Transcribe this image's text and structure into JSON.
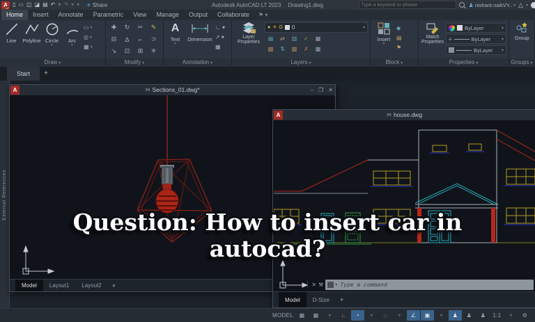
{
  "titlebar": {
    "logo_text": "A",
    "logo_badge": "LT",
    "qat_icons": [
      {
        "name": "new-file-icon",
        "glyph": "▯"
      },
      {
        "name": "open-folder-icon",
        "glyph": "▭"
      },
      {
        "name": "save-icon",
        "glyph": "◫"
      },
      {
        "name": "save-as-icon",
        "glyph": "◪"
      },
      {
        "name": "plot-icon",
        "glyph": "▤"
      },
      {
        "name": "undo-icon",
        "glyph": "↶"
      },
      {
        "name": "undo-dropdown-icon",
        "glyph": "▾",
        "dim": true
      },
      {
        "name": "redo-icon",
        "glyph": "↷",
        "dim": true
      },
      {
        "name": "redo-dropdown-icon",
        "glyph": "▾",
        "dim": true
      },
      {
        "name": "qat-dropdown-icon",
        "glyph": "▾",
        "dim": true
      }
    ],
    "share_label": "Share",
    "app_title": "Autodesk AutoCAD LT 2023",
    "doc_title": "Drawing1.dwg",
    "search_placeholder": "Type a keyword or phrase",
    "user_name": "nishant.naikVY.."
  },
  "menu": {
    "tabs": [
      {
        "name": "menu-tab-home",
        "label": "Home",
        "active": true
      },
      {
        "name": "menu-tab-insert",
        "label": "Insert"
      },
      {
        "name": "menu-tab-annotate",
        "label": "Annotate"
      },
      {
        "name": "menu-tab-parametric",
        "label": "Parametric"
      },
      {
        "name": "menu-tab-view",
        "label": "View"
      },
      {
        "name": "menu-tab-manage",
        "label": "Manage"
      },
      {
        "name": "menu-tab-output",
        "label": "Output"
      },
      {
        "name": "menu-tab-collaborate",
        "label": "Collaborate"
      }
    ],
    "extra_glyph": "⚑ ▾"
  },
  "ribbon": {
    "draw": {
      "label": "Draw",
      "tools": [
        "Line",
        "Polyline",
        "Circle",
        "Arc"
      ],
      "small_icons": [
        {
          "name": "rectangle-tool-icon",
          "glyph": "▭"
        },
        {
          "name": "ellipse-tool-icon",
          "glyph": "◎"
        },
        {
          "name": "hatch-tool-icon",
          "glyph": "▦"
        }
      ]
    },
    "modify": {
      "label": "Modify",
      "icons": [
        {
          "name": "move-icon",
          "glyph": "✚"
        },
        {
          "name": "rotate-icon",
          "glyph": "↻"
        },
        {
          "name": "trim-icon",
          "glyph": "✂"
        },
        {
          "name": "erase-icon",
          "glyph": "✎",
          "color": "#d0b44e"
        },
        {
          "name": "copy-icon",
          "glyph": "⊟"
        },
        {
          "name": "mirror-icon",
          "glyph": "∆"
        },
        {
          "name": "fillet-icon",
          "glyph": "⌐"
        },
        {
          "name": "offset-icon",
          "glyph": "⊃"
        },
        {
          "name": "stretch-icon",
          "glyph": "↘"
        },
        {
          "name": "scale-icon",
          "glyph": "⊡"
        },
        {
          "name": "array-icon",
          "glyph": "⊞"
        },
        {
          "name": "explode-icon",
          "glyph": "✳"
        }
      ]
    },
    "annotation": {
      "label": "Annotation",
      "text_label": "Text",
      "dimension_label": "Dimension",
      "small_icons": [
        {
          "name": "leader-icon",
          "glyph": "∟ ▾"
        },
        {
          "name": "multileader-icon",
          "glyph": "↗ ▾"
        },
        {
          "name": "table-icon",
          "glyph": "▦"
        }
      ]
    },
    "layers": {
      "label": "Layers",
      "big_label_1": "Layer",
      "big_label_2": "Properties",
      "current_layer": "0",
      "state_icons": [
        {
          "name": "layer-on-bulb-icon",
          "glyph": "●",
          "color": "#e2c24a"
        },
        {
          "name": "layer-freeze-sun-icon",
          "glyph": "☀",
          "color": "#dd9c3c"
        },
        {
          "name": "layer-lock-icon",
          "glyph": "Ω",
          "color": "#e2c24a"
        }
      ],
      "tool_icons": [
        {
          "name": "layer-tool-icon",
          "glyph": "▤",
          "color": "#5fa9ad"
        },
        {
          "name": "layer-tool-icon",
          "glyph": "⇄",
          "color": "#c2a262"
        },
        {
          "name": "layer-tool-icon",
          "glyph": "▥",
          "color": "#5fa9ad"
        },
        {
          "name": "layer-tool-icon",
          "glyph": "✓",
          "color": "#8fb360"
        },
        {
          "name": "layer-tool-icon",
          "glyph": "▦",
          "color": "#9aa3ac"
        },
        {
          "name": "layer-tool-icon",
          "glyph": "▧",
          "color": "#c2a262"
        },
        {
          "name": "layer-tool-icon",
          "glyph": "⇅",
          "color": "#5fa9ad"
        },
        {
          "name": "layer-tool-icon",
          "glyph": "▨",
          "color": "#c2a262"
        },
        {
          "name": "layer-tool-icon",
          "glyph": "✗",
          "color": "#b36a5f"
        },
        {
          "name": "layer-tool-icon",
          "glyph": "▩",
          "color": "#9aa3ac"
        }
      ]
    },
    "block": {
      "label": "Block",
      "big_label": "Insert",
      "small_icons": [
        {
          "name": "create-block-icon",
          "glyph": "◆",
          "color": "#5fa9ad"
        },
        {
          "name": "write-block-icon",
          "glyph": "▤",
          "color": "#c2a262"
        },
        {
          "name": "block-attributes-icon",
          "glyph": "⚑",
          "color": "#c2a262"
        }
      ]
    },
    "properties": {
      "label": "Properties",
      "big_label_1": "Match",
      "big_label_2": "Properties",
      "rows": [
        {
          "value": "ByLayer"
        },
        {
          "value": "ByLayer"
        },
        {
          "value": "ByLayer"
        }
      ]
    },
    "groups": {
      "label": "Groups",
      "big_label": "Group"
    }
  },
  "filetabs": {
    "start_label": "Start",
    "new_tab": "+"
  },
  "palette": {
    "label": "External References"
  },
  "left_window": {
    "title": "Sections_01.dwg*",
    "doc_icon": "⋈",
    "controls": [
      {
        "name": "window-minimize-button",
        "glyph": "–"
      },
      {
        "name": "window-restore-button",
        "glyph": "❐"
      },
      {
        "name": "window-close-button",
        "glyph": "✕"
      }
    ],
    "tabs": [
      {
        "name": "layout-tab-model",
        "label": "Model",
        "active": true
      },
      {
        "name": "layout-tab-layout1",
        "label": "Layout1"
      },
      {
        "name": "layout-tab-layout2",
        "label": "Layout2"
      }
    ],
    "new_tab": "+"
  },
  "right_window": {
    "title": "house.dwg",
    "doc_icon": "⋈",
    "command_placeholder": "Type a command",
    "tabs": [
      {
        "name": "layout-tab-model",
        "label": "Model",
        "active": true
      },
      {
        "name": "layout-tab-dsize",
        "label": "D-Size"
      }
    ],
    "new_tab": "+"
  },
  "statusbar": {
    "icons": [
      {
        "name": "model-space-button",
        "glyph": "MODEL"
      },
      {
        "name": "grid-display-icon",
        "glyph": "▦"
      },
      {
        "name": "snap-mode-icon",
        "glyph": "▦"
      },
      {
        "name": "snap-dropdown-icon",
        "glyph": "▾",
        "dim": true
      },
      {
        "name": "ortho-mode-icon",
        "glyph": "∟"
      },
      {
        "name": "polar-tracking-icon",
        "glyph": "◔",
        "active": true
      },
      {
        "name": "polar-dropdown-icon",
        "glyph": "▾",
        "dim": true
      },
      {
        "name": "isodraft-icon",
        "glyph": "◇",
        "dim": true
      },
      {
        "name": "isodraft-dropdown-icon",
        "glyph": "▾",
        "dim": true
      },
      {
        "name": "osnap-tracking-icon",
        "glyph": "∠",
        "active": true
      },
      {
        "name": "osnap-icon",
        "glyph": "▣",
        "active": true
      },
      {
        "name": "osnap-dropdown-icon",
        "glyph": "▾",
        "dim": true
      },
      {
        "name": "annotation-visibility-icon",
        "glyph": "♟",
        "active": true
      },
      {
        "name": "autoscale-icon",
        "glyph": "♟"
      },
      {
        "name": "annotation-scale-icon",
        "glyph": "♟"
      },
      {
        "name": "annotation-scale-value",
        "glyph": "1:1"
      },
      {
        "name": "scale-dropdown-icon",
        "glyph": "▾",
        "dim": true
      },
      {
        "name": "customization-icon",
        "glyph": "⚙"
      }
    ]
  },
  "overlay": {
    "line1": "Question: How to insert car in",
    "line2": "autocad?"
  },
  "colors": {
    "logo_red": "#b03028",
    "share_blue": "#4a9fd8",
    "active_highlight": "#39638c",
    "lamp_red": "#a82517",
    "house_outline": "#aab2ba",
    "house_red": "#b5271a",
    "house_yellow": "#b09a22",
    "house_cyan": "#2aa7b8",
    "house_green": "#2f9e3c",
    "house_blue": "#2a35c8",
    "ground_olive": "#7a7d16"
  }
}
